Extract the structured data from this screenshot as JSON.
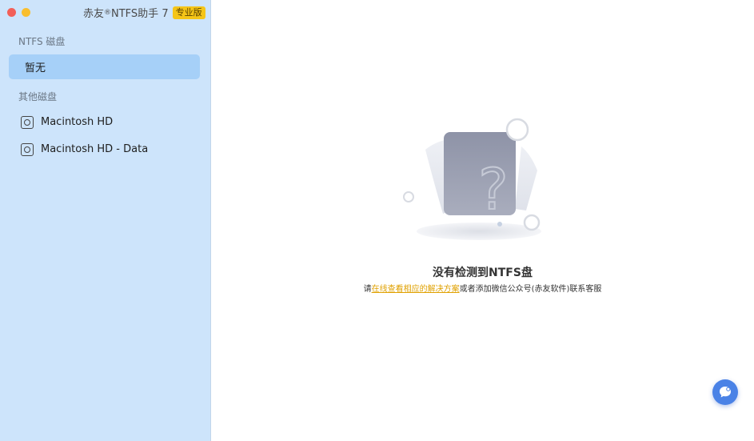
{
  "app": {
    "title_prefix": "赤友",
    "registered": "®",
    "title_suffix": "NTFS助手 7",
    "edition_badge": "专业版"
  },
  "sidebar": {
    "ntfs_section": "NTFS 磁盘",
    "ntfs_items": [
      {
        "label": "暂无",
        "selected": true
      }
    ],
    "other_section": "其他磁盘",
    "other_items": [
      {
        "label": "Macintosh HD",
        "icon": "disk-icon"
      },
      {
        "label": "Macintosh HD - Data",
        "icon": "disk-icon"
      }
    ]
  },
  "main": {
    "empty_title": "没有检测到NTFS盘",
    "empty_desc_prefix": "请",
    "empty_desc_link": "在线查看相应的解决方案",
    "empty_desc_suffix": "或者添加微信公众号(赤友软件)联系客服",
    "illustration_glyph": "?"
  },
  "chat_button": {
    "icon": "chat-bubble-icon",
    "color": "#4a82e6"
  }
}
